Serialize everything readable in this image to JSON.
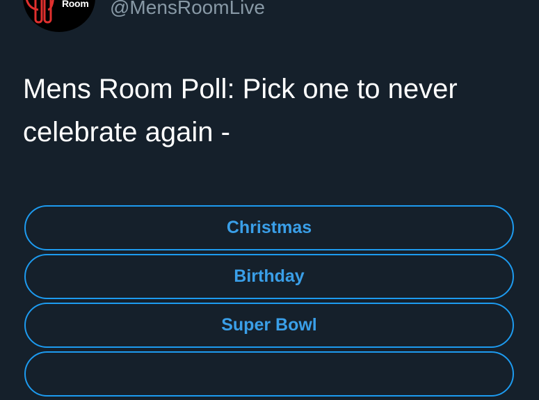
{
  "tweet": {
    "avatar": {
      "logo_text": "Room",
      "logo_icon": "mens-room-logo-icon"
    },
    "handle": "@MensRoomLive",
    "text": "Mens Room Poll: Pick one to never celebrate again -"
  },
  "poll": {
    "options": [
      {
        "label": "Christmas"
      },
      {
        "label": "Birthday"
      },
      {
        "label": "Super Bowl"
      },
      {
        "label": ""
      }
    ]
  },
  "colors": {
    "background": "#15202b",
    "text": "#ffffff",
    "handle": "#8899a6",
    "accent": "#1d9bf0"
  }
}
